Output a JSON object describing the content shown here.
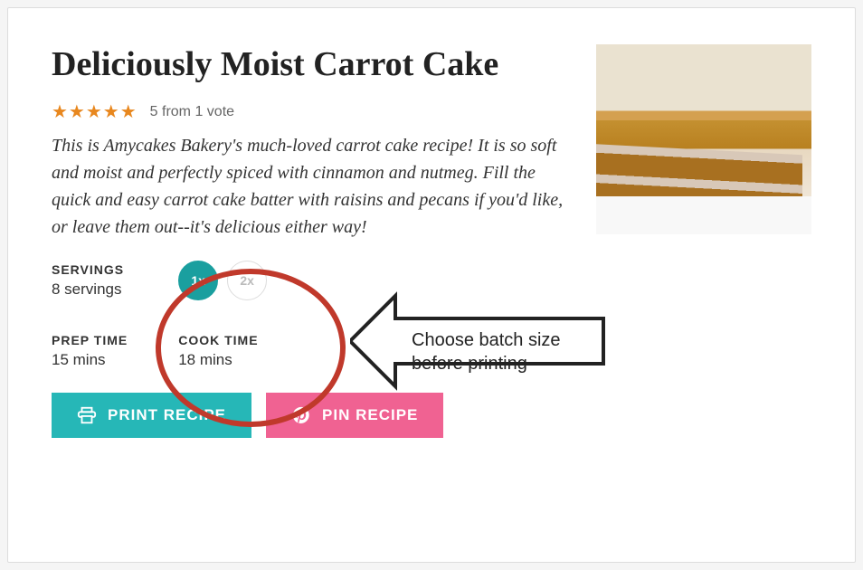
{
  "title": "Deliciously Moist Carrot Cake",
  "rating": {
    "stars": "★★★★★",
    "text": "5 from 1 vote"
  },
  "description": "This is Amycakes Bakery's much-loved carrot cake recipe! It is so soft and moist and perfectly spiced with cinnamon and nutmeg. Fill the quick and easy carrot cake batter with raisins and pecans if you'd like, or leave them out--it's delicious either way!",
  "servings": {
    "label": "SERVINGS",
    "value": "8 servings"
  },
  "batch": {
    "options": [
      "1x",
      "2x"
    ],
    "selected": "1x"
  },
  "times": {
    "prep": {
      "label": "PREP TIME",
      "value": "15 mins"
    },
    "cook": {
      "label": "COOK TIME",
      "value": "18 mins"
    }
  },
  "buttons": {
    "print": "PRINT RECIPE",
    "pin": "PIN RECIPE"
  },
  "annotation": {
    "text1": "Choose batch size",
    "text2": "before printing"
  }
}
